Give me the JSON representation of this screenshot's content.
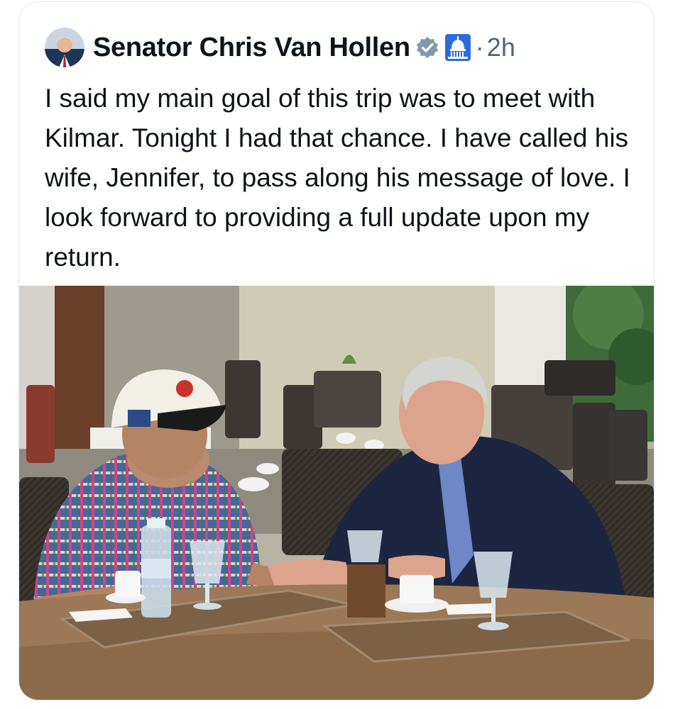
{
  "tweet": {
    "display_name": "Senator Chris Van Hollen",
    "separator": "·",
    "time": "2h",
    "text": "I said my main goal of this trip was to meet with Kilmar. Tonight I had that chance. I have called his wife, Jennifer, to pass along his message of love. I look forward to providing a full update upon my return.",
    "icons": {
      "verified": "verified-badge-icon",
      "affiliation": "capitol-icon"
    },
    "colors": {
      "verified_badge": "#829aab",
      "affiliation_badge": "#2f6bd8"
    }
  }
}
